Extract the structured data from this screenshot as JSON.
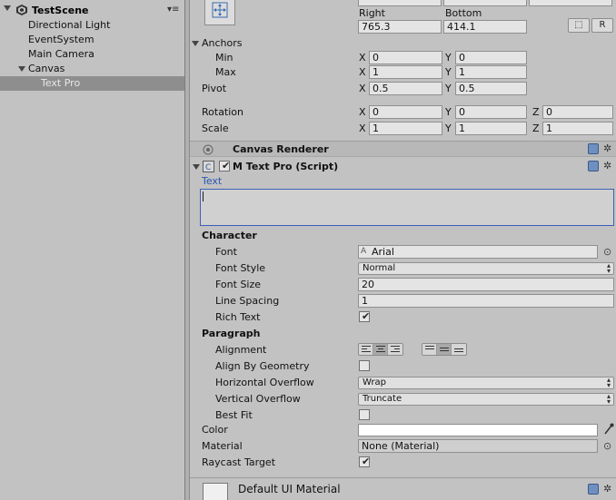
{
  "hierarchy": {
    "scene_name": "TestScene",
    "menu_glyph": "▾≡",
    "items": [
      {
        "label": "Directional Light",
        "indent": 1,
        "selected": false
      },
      {
        "label": "EventSystem",
        "indent": 1,
        "selected": false
      },
      {
        "label": "Main Camera",
        "indent": 1,
        "selected": false
      },
      {
        "label": "Canvas",
        "indent": 1,
        "selected": false,
        "expanded": true
      },
      {
        "label": "Text Pro",
        "indent": 2,
        "selected": true
      }
    ]
  },
  "rect_transform": {
    "right_label": "Right",
    "bottom_label": "Bottom",
    "right_value": "765.3",
    "bottom_value": "414.1",
    "blueprint_button": "⬚",
    "raw_button": "R",
    "anchors_label": "Anchors",
    "min_label": "Min",
    "max_label": "Max",
    "min_x": "0",
    "min_y": "0",
    "max_x": "1",
    "max_y": "1",
    "pivot_label": "Pivot",
    "pivot_x": "0.5",
    "pivot_y": "0.5",
    "rotation_label": "Rotation",
    "rotation_x": "0",
    "rotation_y": "0",
    "rotation_z": "0",
    "scale_label": "Scale",
    "scale_x": "1",
    "scale_y": "1",
    "scale_z": "1",
    "axis_x": "X",
    "axis_y": "Y",
    "axis_z": "Z"
  },
  "canvas_renderer": {
    "title": "Canvas Renderer"
  },
  "script_component": {
    "title": "M Text Pro (Script)",
    "enabled": true,
    "text_label": "Text",
    "text_value": "",
    "character_header": "Character",
    "font_label": "Font",
    "font_value": "Arial",
    "font_style_label": "Font Style",
    "font_style_value": "Normal",
    "font_size_label": "Font Size",
    "font_size_value": "20",
    "line_spacing_label": "Line Spacing",
    "line_spacing_value": "1",
    "rich_text_label": "Rich Text",
    "rich_text_checked": true,
    "paragraph_header": "Paragraph",
    "alignment_label": "Alignment",
    "align_geometry_label": "Align By Geometry",
    "align_geometry_checked": false,
    "h_overflow_label": "Horizontal Overflow",
    "h_overflow_value": "Wrap",
    "v_overflow_label": "Vertical Overflow",
    "v_overflow_value": "Truncate",
    "best_fit_label": "Best Fit",
    "best_fit_checked": false,
    "color_label": "Color",
    "color_value": "#ffffff",
    "material_label": "Material",
    "material_value": "None (Material)",
    "raycast_label": "Raycast Target",
    "raycast_checked": true
  },
  "material_footer": {
    "title": "Default UI Material"
  },
  "icons": {
    "checkmark": "✔",
    "gear": "✲",
    "font_glyph": "A",
    "picker": "⊙",
    "eyedropper": "✎",
    "dropdown_arrows": "▲▼"
  }
}
